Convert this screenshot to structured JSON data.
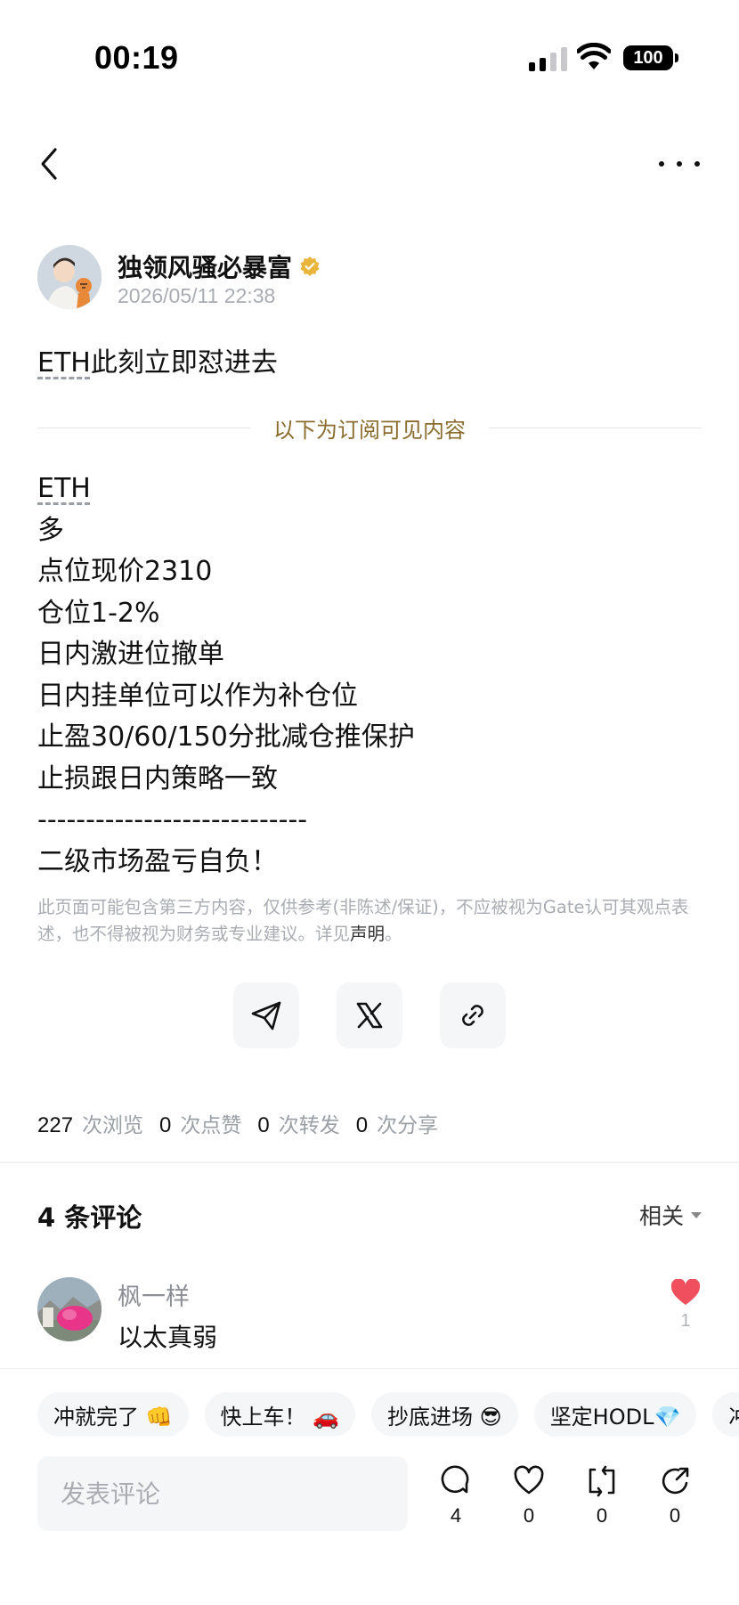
{
  "status_bar": {
    "time": "00:19",
    "battery": "100"
  },
  "author": {
    "name": "独领风骚必暴富",
    "timestamp": "2026/05/11 22:38"
  },
  "post": {
    "title_tag": "ETH",
    "title_rest": "此刻立即怼进去",
    "subscriber_divider": "以下为订阅可见内容",
    "body_tag": "ETH",
    "lines": [
      "多",
      "点位现价2310",
      "仓位1-2%",
      "日内激进位撤单",
      "日内挂单位可以作为补仓位",
      "止盈30/60/150分批减仓推保护",
      "止损跟日内策略一致",
      "----------------------------",
      "二级市场盈亏自负！"
    ],
    "disclaimer": "此页面可能包含第三方内容，仅供参考(非陈述/保证)，不应被视为Gate认可其观点表述，也不得被视为财务或专业建议。详见",
    "disclaimer_link": "声明",
    "disclaimer_end": "。"
  },
  "stats": [
    {
      "num": "227",
      "label": "次浏览"
    },
    {
      "num": "0",
      "label": "次点赞"
    },
    {
      "num": "0",
      "label": "次转发"
    },
    {
      "num": "0",
      "label": "次分享"
    }
  ],
  "comments": {
    "header": "4 条评论",
    "sort": "相关",
    "items": [
      {
        "user": "枫一样",
        "text": "以太真弱",
        "likes": "1"
      }
    ]
  },
  "quick_replies": [
    "冲就完了 👊",
    "快上车！ 🚗",
    "抄底进场 😎",
    "坚定HODL💎",
    "冲"
  ],
  "composer": {
    "placeholder": "发表评论"
  },
  "actions": {
    "comments": "4",
    "likes": "0",
    "reposts": "0",
    "shares": "0"
  },
  "colors": {
    "accent_gold": "#8a6d2e",
    "like_red": "#f0505e",
    "verified_gold": "#e8b43a"
  }
}
